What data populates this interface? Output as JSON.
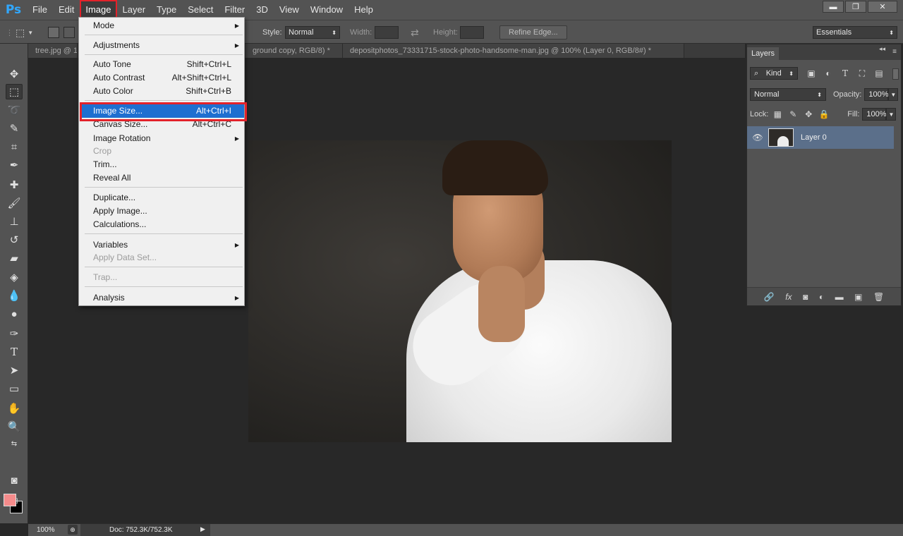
{
  "app": {
    "logo": "Ps"
  },
  "menubar": {
    "items": [
      "File",
      "Edit",
      "Image",
      "Layer",
      "Type",
      "Select",
      "Filter",
      "3D",
      "View",
      "Window",
      "Help"
    ],
    "active": "Image"
  },
  "window_controls": {
    "minimize": "▬",
    "restore": "❐",
    "close": "✕"
  },
  "options": {
    "style_label": "Style:",
    "style_value": "Normal",
    "width_label": "Width:",
    "height_label": "Height:",
    "refine_edge": "Refine Edge...",
    "workspace": "Essentials"
  },
  "tabs": [
    {
      "label": "tree.jpg @ 1",
      "active": false
    },
    {
      "label": "ground copy, RGB/8) *",
      "active": false
    },
    {
      "label": "depositphotos_73331715-stock-photo-handsome-man.jpg @ 100% (Layer 0, RGB/8#) *",
      "active": true
    }
  ],
  "image_menu": {
    "items": [
      {
        "label": "Mode",
        "shortcut": "",
        "submenu": true,
        "disabled": false
      },
      {
        "label": "Adjustments",
        "shortcut": "",
        "submenu": true,
        "disabled": false
      },
      {
        "label": "Auto Tone",
        "shortcut": "Shift+Ctrl+L",
        "submenu": false,
        "disabled": false
      },
      {
        "label": "Auto Contrast",
        "shortcut": "Alt+Shift+Ctrl+L",
        "submenu": false,
        "disabled": false
      },
      {
        "label": "Auto Color",
        "shortcut": "Shift+Ctrl+B",
        "submenu": false,
        "disabled": false
      },
      {
        "label": "Image Size...",
        "shortcut": "Alt+Ctrl+I",
        "submenu": false,
        "disabled": false,
        "highlighted": true
      },
      {
        "label": "Canvas Size...",
        "shortcut": "Alt+Ctrl+C",
        "submenu": false,
        "disabled": false
      },
      {
        "label": "Image Rotation",
        "shortcut": "",
        "submenu": true,
        "disabled": false
      },
      {
        "label": "Crop",
        "shortcut": "",
        "submenu": false,
        "disabled": true
      },
      {
        "label": "Trim...",
        "shortcut": "",
        "submenu": false,
        "disabled": false
      },
      {
        "label": "Reveal All",
        "shortcut": "",
        "submenu": false,
        "disabled": false
      },
      {
        "label": "Duplicate...",
        "shortcut": "",
        "submenu": false,
        "disabled": false
      },
      {
        "label": "Apply Image...",
        "shortcut": "",
        "submenu": false,
        "disabled": false
      },
      {
        "label": "Calculations...",
        "shortcut": "",
        "submenu": false,
        "disabled": false
      },
      {
        "label": "Variables",
        "shortcut": "",
        "submenu": true,
        "disabled": false
      },
      {
        "label": "Apply Data Set...",
        "shortcut": "",
        "submenu": false,
        "disabled": true
      },
      {
        "label": "Trap...",
        "shortcut": "",
        "submenu": false,
        "disabled": true
      },
      {
        "label": "Analysis",
        "shortcut": "",
        "submenu": true,
        "disabled": false
      }
    ],
    "highlight_color": "#e3222a",
    "selection_color": "#1e6fd0"
  },
  "tools": {
    "icons": [
      "move-icon",
      "marquee-icon",
      "lasso-icon",
      "quick-select-icon",
      "crop-icon",
      "eyedropper-icon",
      "healing-icon",
      "brush-icon",
      "stamp-icon",
      "history-brush-icon",
      "eraser-icon",
      "paint-bucket-icon",
      "blur-icon",
      "dodge-icon",
      "pen-icon",
      "type-icon",
      "path-select-icon",
      "rectangle-icon",
      "hand-icon",
      "zoom-icon"
    ],
    "foreground_color": "#f58b8b",
    "background_color": "#000000"
  },
  "layers_panel": {
    "title": "Layers",
    "filter_label": "Kind",
    "blend_mode": "Normal",
    "opacity_label": "Opacity:",
    "opacity_value": "100%",
    "lock_label": "Lock:",
    "fill_label": "Fill:",
    "fill_value": "100%",
    "layers": [
      {
        "name": "Layer 0",
        "visible": true,
        "selected": true
      }
    ]
  },
  "status": {
    "zoom": "100%",
    "doc": "Doc: 752.3K/752.3K"
  }
}
